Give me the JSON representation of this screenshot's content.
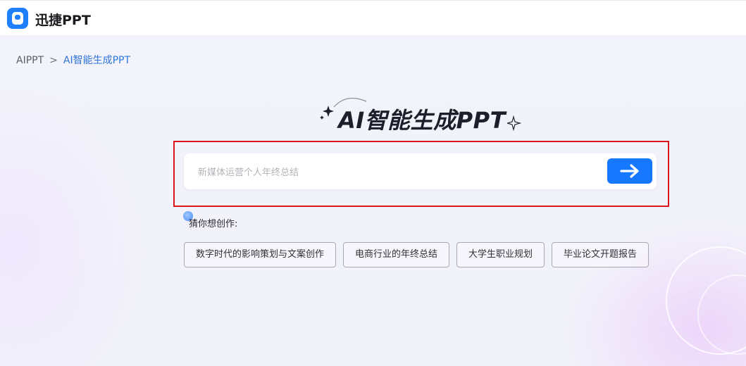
{
  "header": {
    "app_name": "迅捷PPT",
    "logo_icon": "app-logo-icon"
  },
  "breadcrumb": {
    "root": "AIPPT",
    "separator": ">",
    "current": "AI智能生成PPT"
  },
  "hero": {
    "title": "AI智能生成PPT"
  },
  "search": {
    "placeholder": "新媒体运营个人年终总结",
    "value": "",
    "submit_icon": "arrow-right-icon"
  },
  "suggestions": {
    "label": "猜你想创作:",
    "items": [
      "数字时代的影响策划与文案创作",
      "电商行业的年终总结",
      "大学生职业规划",
      "毕业论文开题报告"
    ]
  },
  "colors": {
    "accent": "#1677ff",
    "highlight_border": "#d9141b",
    "breadcrumb_current": "#2f74d9"
  }
}
